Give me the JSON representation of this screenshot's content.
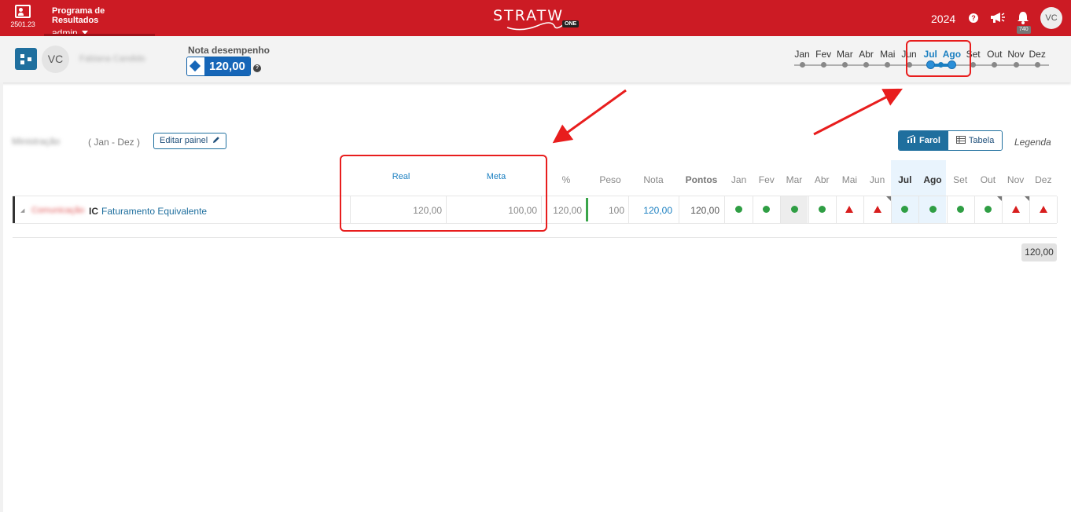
{
  "header": {
    "app_code": "2501.23",
    "program_title": "Programa de Resultados",
    "user": "admin",
    "logo_text": "STRATW",
    "logo_badge": "ONE",
    "year": "2024",
    "help_glyph": "?",
    "notifications": "740",
    "avatar": "VC"
  },
  "subheader": {
    "avatar": "VC",
    "person_name": "Fabiana Candido",
    "score_label": "Nota desempenho",
    "score_value": "120,00",
    "help_glyph": "?",
    "months": [
      "Jan",
      "Fev",
      "Mar",
      "Abr",
      "Mai",
      "Jun",
      "Jul",
      "Ago",
      "Set",
      "Out",
      "Nov",
      "Dez"
    ],
    "selected_range": [
      "Jul",
      "Ago"
    ]
  },
  "panel": {
    "title": "Ministração",
    "range": "( Jan - Dez )",
    "edit_label": "Editar painel",
    "view_farol": "Farol",
    "view_tabela": "Tabela",
    "legend": "Legenda",
    "columns": {
      "real": "Real",
      "meta": "Meta",
      "pct": "%",
      "peso": "Peso",
      "nota": "Nota",
      "pontos": "Pontos",
      "months": [
        "Jan",
        "Fev",
        "Mar",
        "Abr",
        "Mai",
        "Jun",
        "Jul",
        "Ago",
        "Set",
        "Out",
        "Nov",
        "Dez"
      ]
    },
    "row": {
      "owner": "Comunicação",
      "type": "IC",
      "name": "Faturamento Equivalente",
      "real": "120,00",
      "meta": "100,00",
      "pct": "120,00",
      "peso": "100",
      "nota": "120,00",
      "pontos": "120,00",
      "status": [
        "ok",
        "ok",
        "ok",
        "ok",
        "bad",
        "bad",
        "ok",
        "ok",
        "ok",
        "ok",
        "bad",
        "bad"
      ]
    },
    "total": "120,00"
  },
  "colors": {
    "brand": "#cc1b24",
    "accent": "#1f6f9e",
    "ok": "#2f9e44",
    "bad": "#d81e1e",
    "annotation": "#e81d1d"
  }
}
